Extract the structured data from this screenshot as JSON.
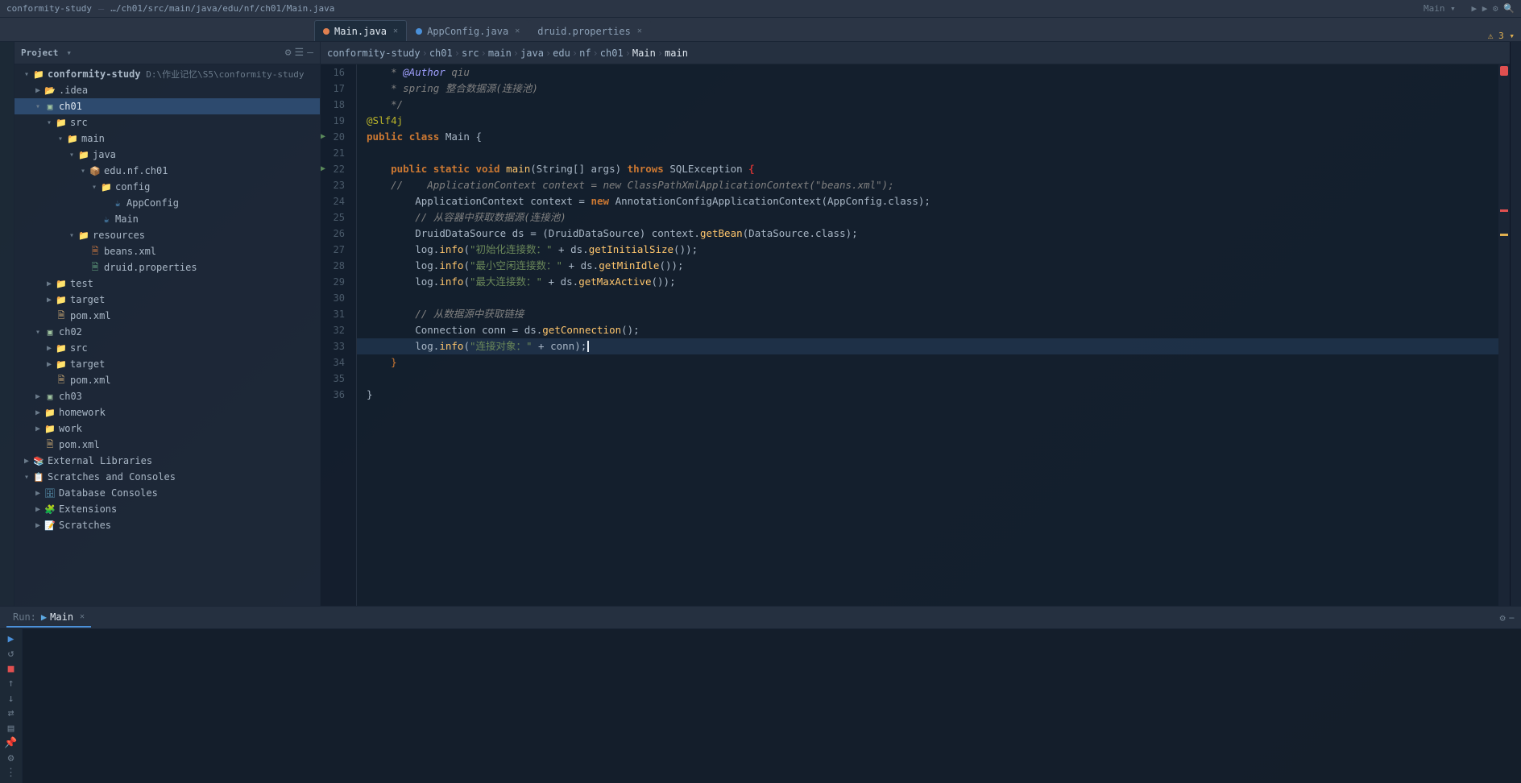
{
  "titlebar": {
    "parts": [
      "conformity-study",
      "ch01",
      "src",
      "main",
      "java",
      "edu",
      "nf",
      "ch01",
      "Main",
      "🔧",
      "Main"
    ]
  },
  "tabs": [
    {
      "id": "main-java",
      "label": "Main.java",
      "dot_color": "orange",
      "active": true
    },
    {
      "id": "appconfig-java",
      "label": "AppConfig.java",
      "dot_color": "blue",
      "active": false
    },
    {
      "id": "druid-properties",
      "label": "druid.properties",
      "dot_color": "none",
      "active": false
    }
  ],
  "breadcrumb": {
    "items": [
      "conformity-study",
      "ch01",
      "src",
      "main",
      "java",
      "edu",
      "nf",
      "ch01",
      "Main",
      "main"
    ]
  },
  "sidebar": {
    "title": "Project",
    "tree": [
      {
        "level": 0,
        "type": "project",
        "label": "conformity-study",
        "sublabel": "D:\\作业记忆\\S5\\conformity-study",
        "expanded": true
      },
      {
        "level": 1,
        "type": "folder-idea",
        "label": ".idea",
        "expanded": false
      },
      {
        "level": 1,
        "type": "folder-module",
        "label": "ch01",
        "expanded": true
      },
      {
        "level": 2,
        "type": "folder-src",
        "label": "src",
        "expanded": true
      },
      {
        "level": 3,
        "type": "folder-main",
        "label": "main",
        "expanded": true
      },
      {
        "level": 4,
        "type": "folder-java",
        "label": "java",
        "expanded": true
      },
      {
        "level": 5,
        "type": "folder-pkg",
        "label": "edu.nf.ch01",
        "expanded": true
      },
      {
        "level": 6,
        "type": "folder-config",
        "label": "config",
        "expanded": true
      },
      {
        "level": 7,
        "type": "java",
        "label": "AppConfig",
        "expanded": false
      },
      {
        "level": 6,
        "type": "java",
        "label": "Main",
        "expanded": false
      },
      {
        "level": 4,
        "type": "folder-res",
        "label": "resources",
        "expanded": true
      },
      {
        "level": 5,
        "type": "xml",
        "label": "beans.xml",
        "expanded": false
      },
      {
        "level": 5,
        "type": "prop",
        "label": "druid.properties",
        "expanded": false
      },
      {
        "level": 2,
        "type": "folder-test",
        "label": "test",
        "expanded": false
      },
      {
        "level": 2,
        "type": "folder-target",
        "label": "target",
        "expanded": false
      },
      {
        "level": 2,
        "type": "xml",
        "label": "pom.xml",
        "expanded": false
      },
      {
        "level": 1,
        "type": "folder-module",
        "label": "ch02",
        "expanded": true
      },
      {
        "level": 2,
        "type": "folder-src",
        "label": "src",
        "expanded": false
      },
      {
        "level": 2,
        "type": "folder-target",
        "label": "target",
        "expanded": false
      },
      {
        "level": 2,
        "type": "xml",
        "label": "pom.xml",
        "expanded": false
      },
      {
        "level": 1,
        "type": "folder-module",
        "label": "ch03",
        "expanded": false
      },
      {
        "level": 1,
        "type": "folder",
        "label": "homework",
        "expanded": false
      },
      {
        "level": 1,
        "type": "folder",
        "label": "work",
        "expanded": false
      },
      {
        "level": 1,
        "type": "xml",
        "label": "pom.xml",
        "expanded": false
      },
      {
        "level": 0,
        "type": "ext-lib",
        "label": "External Libraries",
        "expanded": false
      },
      {
        "level": 0,
        "type": "scratch-console",
        "label": "Scratches and Consoles",
        "expanded": true
      },
      {
        "level": 1,
        "type": "db-console",
        "label": "Database Consoles",
        "expanded": false
      },
      {
        "level": 1,
        "type": "ext",
        "label": "Extensions",
        "expanded": false
      },
      {
        "level": 1,
        "type": "scratch",
        "label": "Scratches",
        "expanded": false
      }
    ]
  },
  "editor": {
    "filename": "Main.java",
    "lines": [
      {
        "num": 16,
        "content": "    * @Author qiu",
        "type": "comment"
      },
      {
        "num": 17,
        "content": "    * spring 整合数据源(连接池)",
        "type": "comment"
      },
      {
        "num": 18,
        "content": "    */",
        "type": "comment"
      },
      {
        "num": 19,
        "content": "@Slf4j",
        "type": "annotation"
      },
      {
        "num": 20,
        "content": "public class Main {",
        "type": "class-decl",
        "arrow": true
      },
      {
        "num": 21,
        "content": "",
        "type": "empty"
      },
      {
        "num": 22,
        "content": "    public static void main(String[] args) throws SQLException {",
        "type": "method-decl",
        "arrow": true
      },
      {
        "num": 23,
        "content": "    //    ApplicationContext context = new ClassPathXmlApplicationContext(\"beans.xml\");",
        "type": "comment-line"
      },
      {
        "num": 24,
        "content": "        ApplicationContext context = new AnnotationConfigApplicationContext(AppConfig.class);",
        "type": "code"
      },
      {
        "num": 25,
        "content": "        // 从容器中获取数据源(连接池)",
        "type": "comment-line2"
      },
      {
        "num": 26,
        "content": "        DruidDataSource ds = (DruidDataSource) context.getBean(DataSource.class);",
        "type": "code"
      },
      {
        "num": 27,
        "content": "        log.info(\"初始化连接数：\" + ds.getInitialSize());",
        "type": "code"
      },
      {
        "num": 28,
        "content": "        log.info(\"最小空闲连接数：\" + ds.getMinIdle());",
        "type": "code"
      },
      {
        "num": 29,
        "content": "        log.info(\"最大连接数：\" + ds.getMaxActive());",
        "type": "code"
      },
      {
        "num": 30,
        "content": "",
        "type": "empty"
      },
      {
        "num": 31,
        "content": "        // 从数据源中获取链接",
        "type": "comment-line2"
      },
      {
        "num": 32,
        "content": "        Connection conn = ds.getConnection();",
        "type": "code"
      },
      {
        "num": 33,
        "content": "        log.info(\"连接对象：\" + conn);",
        "type": "code",
        "cursor": true
      },
      {
        "num": 34,
        "content": "    }",
        "type": "close-brace"
      },
      {
        "num": 35,
        "content": "",
        "type": "empty"
      },
      {
        "num": 36,
        "content": "}",
        "type": "close-brace"
      }
    ]
  },
  "bottom_panel": {
    "tab_label": "Run:",
    "run_config": "Main",
    "icons": {
      "settings": "⚙",
      "minimize": "−"
    }
  },
  "left_icons": [
    "▶",
    "◎",
    "↑",
    "↓",
    "—",
    "✦",
    "⊞",
    "◉",
    "▤",
    "⚡",
    "☁",
    "⬡"
  ]
}
